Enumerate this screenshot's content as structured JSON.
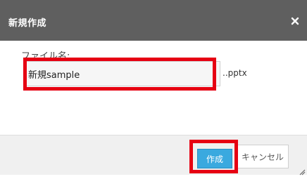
{
  "dialog": {
    "title": "新規作成",
    "close_icon": "close-icon"
  },
  "form": {
    "label": "ファイル名:",
    "filename_value": "新規sample",
    "extension": "..pptx"
  },
  "buttons": {
    "create_label": "作成",
    "cancel_label": "キャンセル"
  },
  "colors": {
    "titlebar": "#5f5f5f",
    "primary": "#3aa9df",
    "highlight": "#e60012",
    "footer": "#f0f0f0"
  },
  "icons": {
    "resize": "resize-grip-icon"
  }
}
